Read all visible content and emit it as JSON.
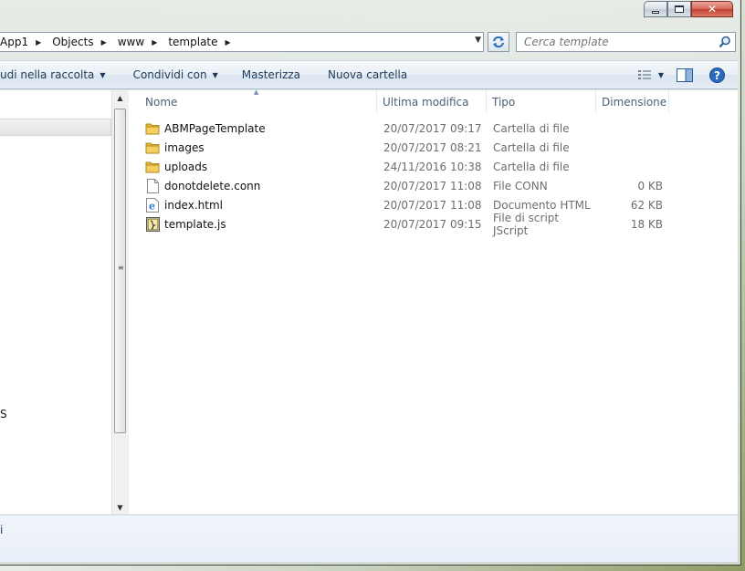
{
  "window": {
    "buttons": {
      "minimize": "minimize-icon",
      "maximize": "maximize-icon",
      "close": "✕"
    }
  },
  "address": {
    "crumbs": [
      "App1",
      "Objects",
      "www",
      "template"
    ],
    "search_placeholder": "Cerca template"
  },
  "toolbar": {
    "include_label": "udi nella raccolta",
    "share_label": "Condividi con",
    "burn_label": "Masterizza",
    "new_folder_label": "Nuova cartella",
    "help_label": "?"
  },
  "nav": {
    "partial_label": "S"
  },
  "columns": {
    "name": "Nome",
    "modified": "Ultima modifica",
    "type": "Tipo",
    "size": "Dimensione"
  },
  "files": [
    {
      "name": "ABMPageTemplate",
      "modified": "20/07/2017 09:17",
      "type": "Cartella di file",
      "size": "",
      "icon": "folder-icon"
    },
    {
      "name": "images",
      "modified": "20/07/2017 08:21",
      "type": "Cartella di file",
      "size": "",
      "icon": "folder-icon"
    },
    {
      "name": "uploads",
      "modified": "24/11/2016 10:38",
      "type": "Cartella di file",
      "size": "",
      "icon": "folder-icon"
    },
    {
      "name": "donotdelete.conn",
      "modified": "20/07/2017 11:08",
      "type": "File CONN",
      "size": "0 KB",
      "icon": "document-icon"
    },
    {
      "name": "index.html",
      "modified": "20/07/2017 11:08",
      "type": "Documento HTML",
      "size": "62 KB",
      "icon": "html-file-icon"
    },
    {
      "name": "template.js",
      "modified": "20/07/2017 09:15",
      "type": "File di script JScript",
      "size": "18 KB",
      "icon": "script-file-icon"
    }
  ],
  "details": {
    "partial_label": "i"
  },
  "colors": {
    "toolbar_text": "#1e395b",
    "header_text": "#4c607a",
    "folder": "#e8b83a",
    "ie_blue": "#2a7ad8"
  }
}
